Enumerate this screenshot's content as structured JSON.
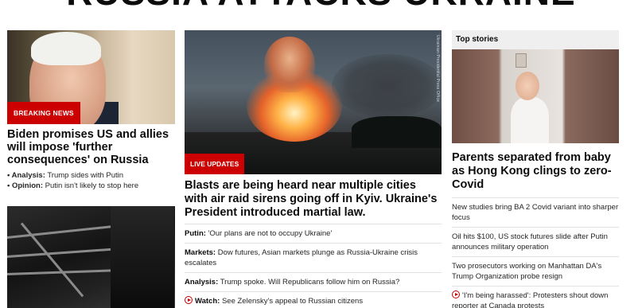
{
  "banner": {
    "text": "RUSSIA ATTACKS UKRAINE"
  },
  "left": {
    "badge": "BREAKING NEWS",
    "headline": "Biden promises US and allies will impose 'further consequences' on Russia",
    "bullets": [
      {
        "label": "Analysis:",
        "text": "Trump sides with Putin"
      },
      {
        "label": "Opinion:",
        "text": "Putin isn't likely to stop here"
      }
    ]
  },
  "center": {
    "photo_credit": "Ukrainian Presidential Press Office",
    "badge": "LIVE UPDATES",
    "headline": "Blasts are being heard near multiple cities with air raid sirens going off in Kyiv. Ukraine's President introduced martial law.",
    "items": [
      {
        "label": "Putin:",
        "text": "'Our plans are not to occupy Ukraine'"
      },
      {
        "label": "Markets:",
        "text": "Dow futures, Asian markets plunge as Russia-Ukraine crisis escalates"
      },
      {
        "label": "Analysis:",
        "text": "Trump spoke. Will Republicans follow him on Russia?"
      },
      {
        "label": "Watch:",
        "text": "See Zelensky's appeal to Russian citizens",
        "icon": "play-icon"
      }
    ]
  },
  "right": {
    "section_title": "Top stories",
    "headline": "Parents separated from baby as Hong Kong clings to zero-Covid",
    "items": [
      {
        "text": "New studies bring BA 2 Covid variant into sharper focus"
      },
      {
        "text": "Oil hits $100, US stock futures slide after Putin announces military operation"
      },
      {
        "text": "Two prosecutors working on Manhattan DA's Trump Organization probe resign"
      },
      {
        "text": "'I'm being harassed': Protesters shout down reporter at Canada protests",
        "icon": "play-icon"
      }
    ]
  },
  "colors": {
    "accent_red": "#cc0000",
    "text": "#0c0c0c",
    "section_bg": "#efefef"
  }
}
